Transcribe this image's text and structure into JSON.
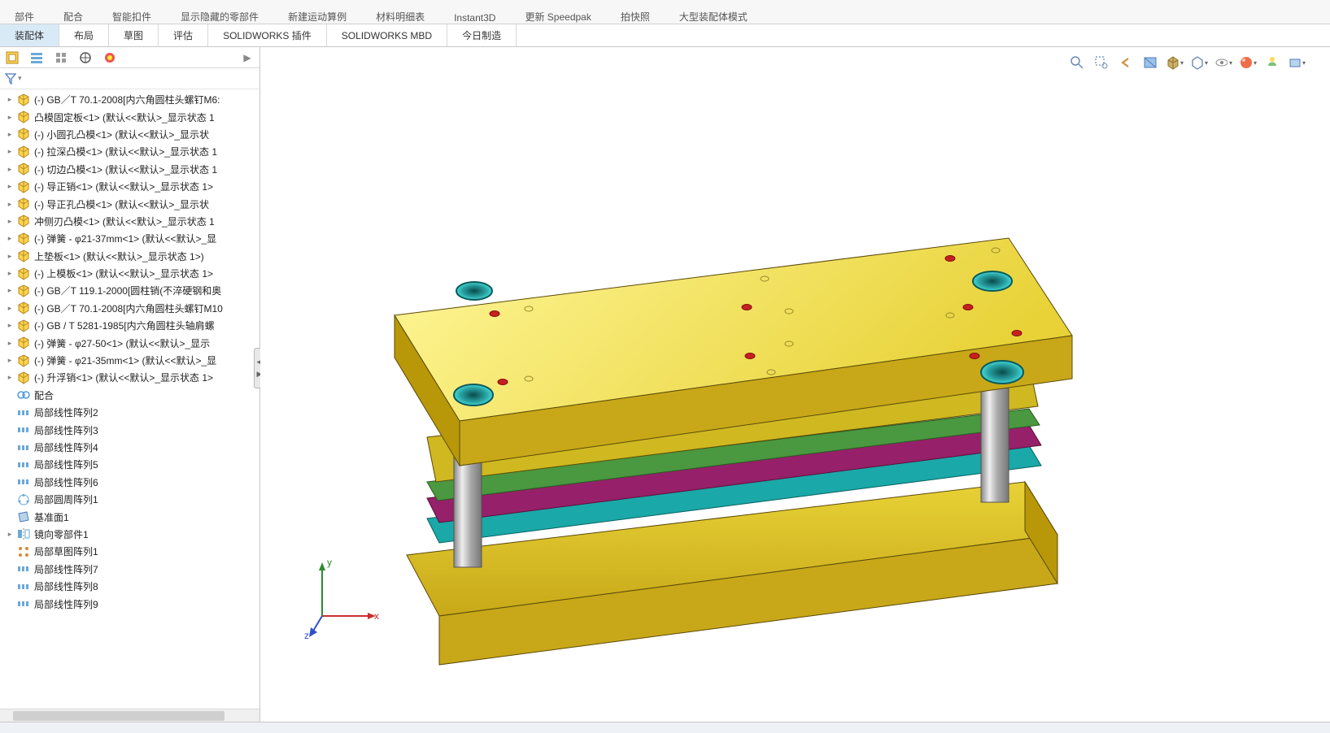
{
  "ribbon_groups": [
    "部件",
    "配合",
    "智能扣件",
    "显示隐藏的零部件",
    "新建运动算例",
    "材料明细表",
    "Instant3D",
    "更新 Speedpak",
    "拍快照",
    "大型装配体模式"
  ],
  "cmd_tabs": [
    "装配体",
    "布局",
    "草图",
    "评估",
    "SOLIDWORKS 插件",
    "SOLIDWORKS MBD",
    "今日制造"
  ],
  "active_cmd_tab": 0,
  "filter_icon": "filter-icon",
  "tree_items": [
    {
      "expand": true,
      "icon": "part",
      "label": "(-) GB／T 70.1-2008[内六角圆柱头螺钉M6:"
    },
    {
      "expand": true,
      "icon": "part",
      "label": "凸模固定板<1> (默认<<默认>_显示状态 1"
    },
    {
      "expand": true,
      "icon": "part",
      "label": "(-) 小圆孔凸模<1> (默认<<默认>_显示状"
    },
    {
      "expand": true,
      "icon": "part",
      "label": "(-) 拉深凸模<1> (默认<<默认>_显示状态 1"
    },
    {
      "expand": true,
      "icon": "part",
      "label": "(-) 切边凸模<1> (默认<<默认>_显示状态 1"
    },
    {
      "expand": true,
      "icon": "part",
      "label": "(-) 导正销<1> (默认<<默认>_显示状态 1>"
    },
    {
      "expand": true,
      "icon": "part",
      "label": "(-) 导正孔凸模<1> (默认<<默认>_显示状"
    },
    {
      "expand": true,
      "icon": "part",
      "label": "冲侧刃凸模<1> (默认<<默认>_显示状态 1"
    },
    {
      "expand": true,
      "icon": "part",
      "label": "(-) 弹簧 - φ21-37mm<1> (默认<<默认>_显"
    },
    {
      "expand": true,
      "icon": "part",
      "label": "上垫板<1> (默认<<默认>_显示状态 1>)"
    },
    {
      "expand": true,
      "icon": "part",
      "label": "(-) 上模板<1> (默认<<默认>_显示状态 1>"
    },
    {
      "expand": true,
      "icon": "part",
      "label": "(-) GB／T 119.1-2000[圆柱销(不淬硬钢和奥"
    },
    {
      "expand": true,
      "icon": "part",
      "label": "(-) GB／T 70.1-2008[内六角圆柱头螺钉M10"
    },
    {
      "expand": true,
      "icon": "part",
      "label": "(-) GB / T 5281-1985[内六角圆柱头轴肩螺"
    },
    {
      "expand": true,
      "icon": "part",
      "label": "(-) 弹簧 - φ27-50<1> (默认<<默认>_显示"
    },
    {
      "expand": true,
      "icon": "part",
      "label": "(-) 弹簧 - φ21-35mm<1> (默认<<默认>_显"
    },
    {
      "expand": true,
      "icon": "part",
      "label": "(-) 升浮销<1> (默认<<默认>_显示状态 1>"
    },
    {
      "expand": false,
      "icon": "mates",
      "label": "配合"
    },
    {
      "expand": false,
      "icon": "pattern",
      "label": "局部线性阵列2"
    },
    {
      "expand": false,
      "icon": "pattern",
      "label": "局部线性阵列3"
    },
    {
      "expand": false,
      "icon": "pattern",
      "label": "局部线性阵列4"
    },
    {
      "expand": false,
      "icon": "pattern",
      "label": "局部线性阵列5"
    },
    {
      "expand": false,
      "icon": "pattern",
      "label": "局部线性阵列6"
    },
    {
      "expand": false,
      "icon": "circpat",
      "label": "局部圆周阵列1"
    },
    {
      "expand": false,
      "icon": "plane",
      "label": "基准面1"
    },
    {
      "expand": true,
      "icon": "mirror",
      "label": "镜向零部件1"
    },
    {
      "expand": false,
      "icon": "sketchpat",
      "label": "局部草图阵列1"
    },
    {
      "expand": false,
      "icon": "pattern",
      "label": "局部线性阵列7"
    },
    {
      "expand": false,
      "icon": "pattern",
      "label": "局部线性阵列8"
    },
    {
      "expand": false,
      "icon": "pattern",
      "label": "局部线性阵列9"
    }
  ],
  "vp_tools": [
    "zoom-fit",
    "zoom-area",
    "prev-view",
    "section",
    "display-state",
    "scene",
    "view-orient",
    "display-style",
    "hide-show",
    "appearance",
    "render",
    "capture",
    "view-settings"
  ],
  "triad": {
    "x": "x",
    "y": "y",
    "z": "z"
  }
}
